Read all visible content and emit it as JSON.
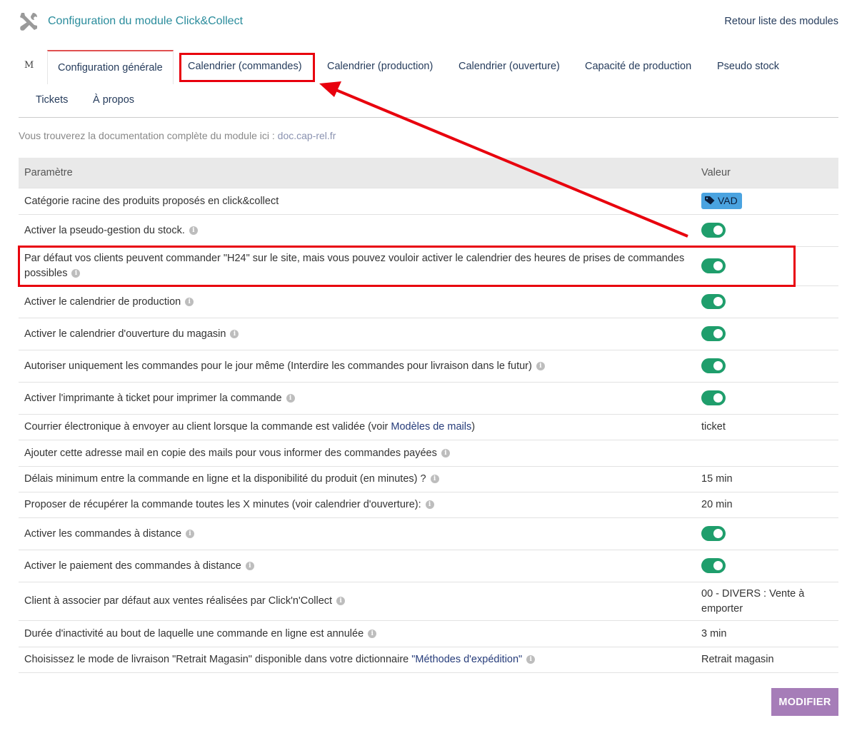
{
  "header": {
    "title": "Configuration du module Click&Collect",
    "back_link": "Retour liste des modules"
  },
  "tabs": {
    "first": "M",
    "row1": [
      "Configuration générale",
      "Calendrier (commandes)",
      "Calendrier (production)",
      "Calendrier (ouverture)",
      "Capacité de production",
      "Pseudo stock"
    ],
    "row2": [
      "Tickets",
      "À propos"
    ]
  },
  "doc": {
    "text": "Vous trouverez la documentation complète du module ici : ",
    "link": "doc.cap-rel.fr"
  },
  "table": {
    "header_param": "Paramètre",
    "header_value": "Valeur",
    "rows": [
      {
        "label": "Catégorie racine des produits proposés en click&collect",
        "value": "VAD",
        "type": "badge"
      },
      {
        "label": "Activer la pseudo-gestion du stock.",
        "type": "toggle",
        "on": true
      },
      {
        "label": "Par défaut vos clients peuvent commander \"H24\" sur le site, mais vous pouvez vouloir activer le calendrier des heures de prises de commandes possibles",
        "type": "toggle",
        "on": true
      },
      {
        "label": "Activer le calendrier de production",
        "type": "toggle",
        "on": true
      },
      {
        "label": "Activer le calendrier d'ouverture du magasin",
        "type": "toggle",
        "on": true
      },
      {
        "label": "Autoriser uniquement les commandes pour le jour même (Interdire les commandes pour livraison dans le futur)",
        "type": "toggle",
        "on": true
      },
      {
        "label": "Activer l'imprimante à ticket pour imprimer la commande",
        "type": "toggle",
        "on": true
      },
      {
        "label": "Courrier électronique à envoyer au client lorsque la commande est validée (voir ",
        "link": "Modèles de mails",
        "label_after": ")",
        "value": "ticket",
        "type": "text"
      },
      {
        "label": "Ajouter cette adresse mail en copie des mails pour vous informer des commandes payées",
        "value": "",
        "type": "text"
      },
      {
        "label": "Délais minimum entre la commande en ligne et la disponibilité du produit (en minutes) ?",
        "value": "15 min",
        "type": "text"
      },
      {
        "label": "Proposer de récupérer la commande toutes les X minutes (voir calendrier d'ouverture):",
        "value": "20 min",
        "type": "text"
      },
      {
        "label": "Activer les commandes à distance",
        "type": "toggle",
        "on": true
      },
      {
        "label": "Activer le paiement des commandes à distance",
        "type": "toggle",
        "on": true
      },
      {
        "label": "Client à associer par défaut aux ventes réalisées par Click'n'Collect",
        "value": "00 - DIVERS : Vente à emporter",
        "type": "text"
      },
      {
        "label": "Durée d'inactivité au bout de laquelle une commande en ligne est annulée",
        "value": "3 min",
        "type": "text"
      },
      {
        "label": "Choisissez le mode de livraison \"Retrait Magasin\" disponible dans votre dictionnaire ",
        "link": "\"Méthodes d'expédition\"",
        "value": "Retrait magasin",
        "type": "text"
      }
    ]
  },
  "buttons": {
    "modifier": "MODIFIER"
  },
  "colors": {
    "accent_teal": "#2a8c9c",
    "toggle_on": "#1f9e6c",
    "badge": "#4aa3e0",
    "button": "#a67db8",
    "highlight": "#e8000d"
  },
  "icons": {
    "header": "tools-icon",
    "info": "info-icon",
    "tag": "tag-icon"
  }
}
